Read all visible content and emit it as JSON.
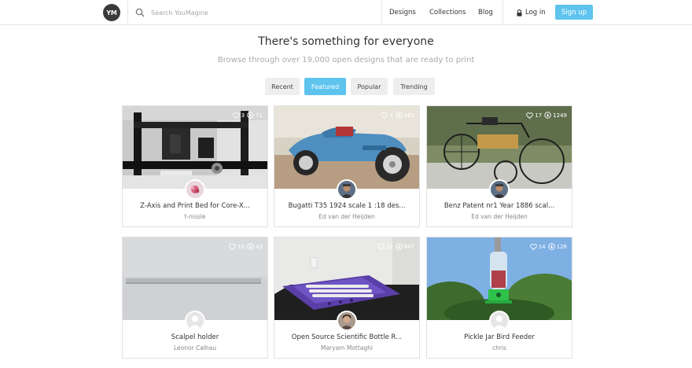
{
  "header": {
    "logo": "YM",
    "search_placeholder": "Search YouMagine",
    "nav": [
      "Designs",
      "Collections",
      "Blog"
    ],
    "login": "Log in",
    "signup": "Sign up"
  },
  "hero": {
    "title": "There's something for everyone",
    "subtitle": "Browse through over 19,000 open designs that are ready to print"
  },
  "tabs": [
    {
      "label": "Recent",
      "active": false
    },
    {
      "label": "Featured",
      "active": true
    },
    {
      "label": "Popular",
      "active": false
    },
    {
      "label": "Trending",
      "active": false
    }
  ],
  "cards": [
    {
      "title": "Z-Axis and Print Bed for Core-X...",
      "author": "t-nissle",
      "likes": "3",
      "downloads": "71"
    },
    {
      "title": "Bugatti T35 1924 scale 1 :18 des...",
      "author": "Ed van der Heijden",
      "likes": "4",
      "downloads": "563"
    },
    {
      "title": "Benz Patent nr1 Year 1886 scal...",
      "author": "Ed van der Heijden",
      "likes": "17",
      "downloads": "1249"
    },
    {
      "title": "Scalpel holder",
      "author": "Leonor Calhau",
      "likes": "10",
      "downloads": "43"
    },
    {
      "title": "Open Source Scientific Bottle R...",
      "author": "Maryam Mottaghi",
      "likes": "12",
      "downloads": "847"
    },
    {
      "title": "Pickle Jar Bird Feeder",
      "author": "chris",
      "likes": "14",
      "downloads": "126"
    }
  ],
  "colors": {
    "accent": "#5ec4ee",
    "tab_bg": "#eeeeee"
  }
}
